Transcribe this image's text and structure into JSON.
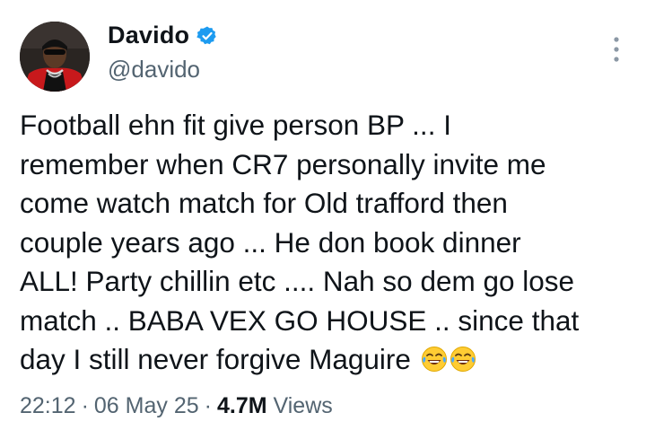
{
  "author": {
    "display_name": "Davido",
    "handle": "@davido",
    "verified": true,
    "avatar_icon": "profile-photo"
  },
  "tweet": {
    "lines": [
      "Football ehn fit give person BP ... I",
      "remember when CR7 personally invite me",
      "come watch match for Old trafford then",
      "couple years ago ... He don book dinner",
      "ALL! Party chillin etc .... Nah so dem go lose",
      "match .. BABA VEX GO HOUSE .. since that",
      "day I still never forgive Maguire"
    ],
    "emojis": [
      "😂",
      "😂"
    ]
  },
  "meta": {
    "time": "22:12",
    "separator": "·",
    "date": "06 May 25",
    "views_count": "4.7M",
    "views_label": "Views"
  },
  "colors": {
    "text": "#0f1419",
    "secondary": "#536471",
    "verified": "#1d9bf0"
  }
}
